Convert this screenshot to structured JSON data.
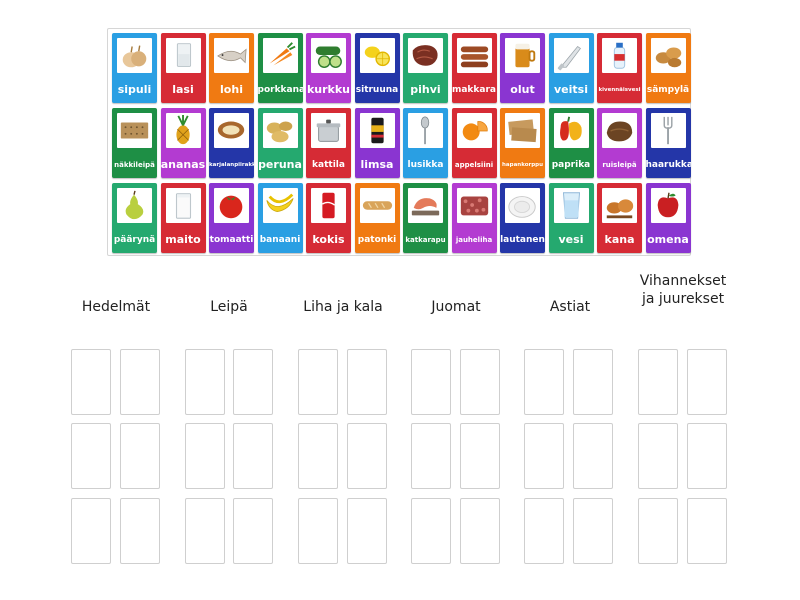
{
  "colors": {
    "blue": "#2a9fe3",
    "red": "#d62b35",
    "orange": "#f07a12",
    "green": "#1e8f45",
    "violet": "#b33bd1",
    "navy": "#2436a8",
    "teal": "#25a96f",
    "purple": "#8a35d1"
  },
  "cards": [
    {
      "label": "sipuli",
      "color": "blue",
      "icon": "onion-icon"
    },
    {
      "label": "lasi",
      "color": "red",
      "icon": "glass-icon"
    },
    {
      "label": "lohi",
      "color": "orange",
      "icon": "salmon-icon"
    },
    {
      "label": "porkkana",
      "color": "green",
      "icon": "carrot-icon"
    },
    {
      "label": "kurkku",
      "color": "violet",
      "icon": "cucumber-icon"
    },
    {
      "label": "sitruuna",
      "color": "navy",
      "icon": "lemon-icon"
    },
    {
      "label": "pihvi",
      "color": "teal",
      "icon": "steak-icon"
    },
    {
      "label": "makkara",
      "color": "red",
      "icon": "sausage-icon"
    },
    {
      "label": "olut",
      "color": "purple",
      "icon": "beer-icon"
    },
    {
      "label": "veitsi",
      "color": "blue",
      "icon": "knife-icon"
    },
    {
      "label": "kivennäisvesi",
      "color": "red",
      "icon": "water-bottle-icon"
    },
    {
      "label": "sämpylä",
      "color": "orange",
      "icon": "bread-roll-icon"
    },
    {
      "label": "näkkileipä",
      "color": "green",
      "icon": "crispbread-icon"
    },
    {
      "label": "ananas",
      "color": "violet",
      "icon": "pineapple-icon"
    },
    {
      "label": "karjalanpiirakka",
      "color": "navy",
      "icon": "karelian-pie-icon"
    },
    {
      "label": "peruna",
      "color": "teal",
      "icon": "potato-icon"
    },
    {
      "label": "kattila",
      "color": "red",
      "icon": "pot-icon"
    },
    {
      "label": "limsa",
      "color": "purple",
      "icon": "soda-can-icon"
    },
    {
      "label": "lusikka",
      "color": "blue",
      "icon": "spoon-icon"
    },
    {
      "label": "appelsiini",
      "color": "red",
      "icon": "orange-fruit-icon"
    },
    {
      "label": "hapankorppu",
      "color": "orange",
      "icon": "rusk-icon"
    },
    {
      "label": "paprika",
      "color": "green",
      "icon": "bell-pepper-icon"
    },
    {
      "label": "ruisleipä",
      "color": "violet",
      "icon": "rye-bread-icon"
    },
    {
      "label": "haarukka",
      "color": "navy",
      "icon": "fork-icon"
    },
    {
      "label": "päärynä",
      "color": "teal",
      "icon": "pear-icon"
    },
    {
      "label": "maito",
      "color": "red",
      "icon": "milk-icon"
    },
    {
      "label": "tomaatti",
      "color": "purple",
      "icon": "tomato-icon"
    },
    {
      "label": "banaani",
      "color": "blue",
      "icon": "banana-icon"
    },
    {
      "label": "kokis",
      "color": "red",
      "icon": "cola-can-icon"
    },
    {
      "label": "patonki",
      "color": "orange",
      "icon": "baguette-icon"
    },
    {
      "label": "katkarapu",
      "color": "green",
      "icon": "shrimp-icon"
    },
    {
      "label": "jauheliha",
      "color": "violet",
      "icon": "minced-meat-icon"
    },
    {
      "label": "lautanen",
      "color": "navy",
      "icon": "plate-icon"
    },
    {
      "label": "vesi",
      "color": "teal",
      "icon": "water-glass-icon"
    },
    {
      "label": "kana",
      "color": "red",
      "icon": "chicken-icon"
    },
    {
      "label": "omena",
      "color": "purple",
      "icon": "apple-icon"
    }
  ],
  "categories": [
    {
      "title": "Hedelmät"
    },
    {
      "title": "Leipä"
    },
    {
      "title": "Liha ja kala"
    },
    {
      "title": "Juomat"
    },
    {
      "title": "Astiat"
    },
    {
      "title": "Vihannekset ja juurekset"
    }
  ]
}
